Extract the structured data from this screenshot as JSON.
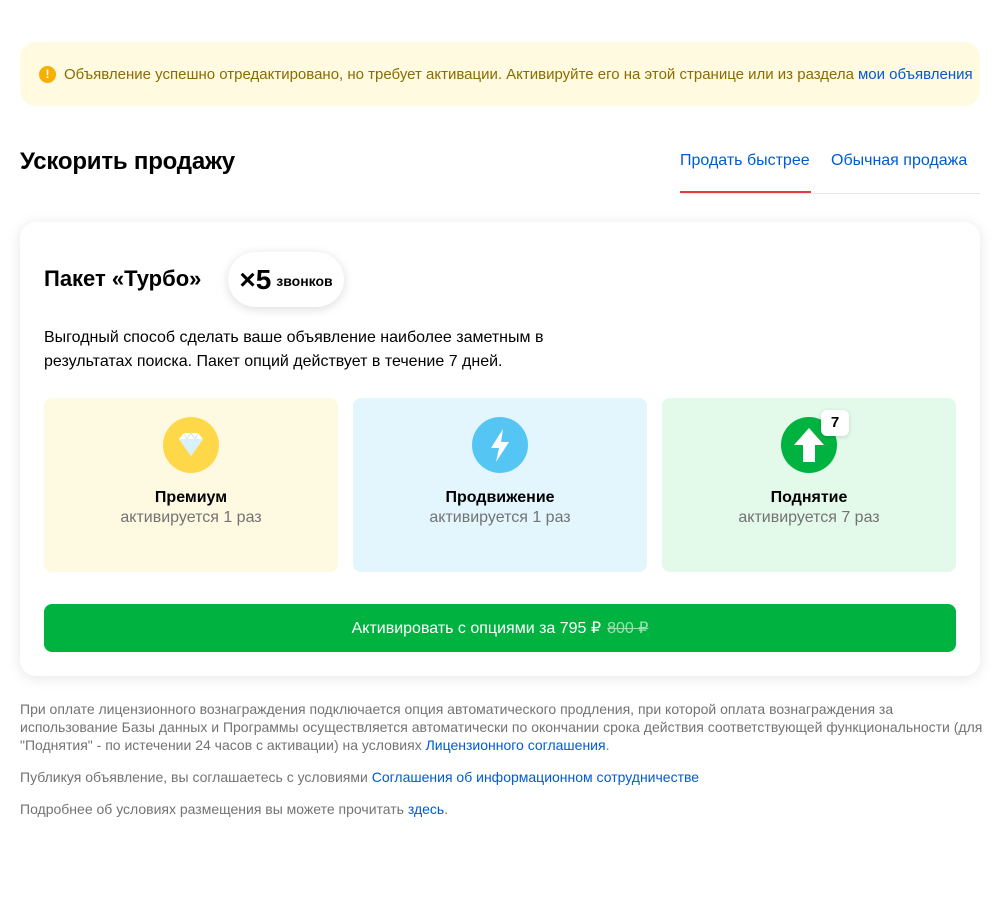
{
  "notice": {
    "text": "Объявление успешно отредактировано, но требует активации. Активируйте его на этой странице или из раздела",
    "link": "мои объявления",
    "icon": "warning-icon"
  },
  "section": {
    "title": "Ускорить продажу",
    "tabs": [
      {
        "label": "Продать быстрее",
        "active": true
      },
      {
        "label": "Обычная продажа",
        "active": false
      }
    ]
  },
  "package": {
    "title": "Пакет «Турбо»",
    "badge_multiplier": "×5",
    "badge_unit": "звонков",
    "description": "Выгодный способ сделать ваше объявление наиболее заметным в результатах поиска. Пакет опций действует в течение 7 дней.",
    "options": [
      {
        "name": "Премиум",
        "sub": "активируется 1 раз",
        "icon": "diamond-icon",
        "color": "#ffd84a"
      },
      {
        "name": "Продвижение",
        "sub": "активируется 1 раз",
        "icon": "lightning-icon",
        "color": "#55c6f4"
      },
      {
        "name": "Поднятие",
        "sub": "активируется 7 раз",
        "icon": "arrow-up-icon",
        "color": "#00b341",
        "badge": "7"
      }
    ],
    "button": {
      "label": "Активировать с опциями за 795 ₽",
      "old_price": "800 ₽",
      "color": "#00b341"
    }
  },
  "legal": {
    "p1_text": "При оплате лицензионного вознаграждения подключается опция автоматического продления, при которой оплата вознаграждения за использование Базы данных и Программы осуществляется автоматически по окончании срока действия соответствующей функциональности (для \"Поднятия\" - по истечении 24 часов с активации) на условиях",
    "p1_link": "Лицензионного соглашения",
    "p1_end": ".",
    "p2_text": "Публикуя объявление, вы соглашаетесь с условиями",
    "p2_link": "Соглашения об информационном сотрудничестве",
    "p3_text": "Подробнее об условиях размещения вы можете прочитать",
    "p3_link": "здесь",
    "p3_end": "."
  },
  "colors": {
    "accent_link": "#005bd1",
    "tab_underline": "#e23c3c",
    "notice_bg": "#fffae0"
  }
}
